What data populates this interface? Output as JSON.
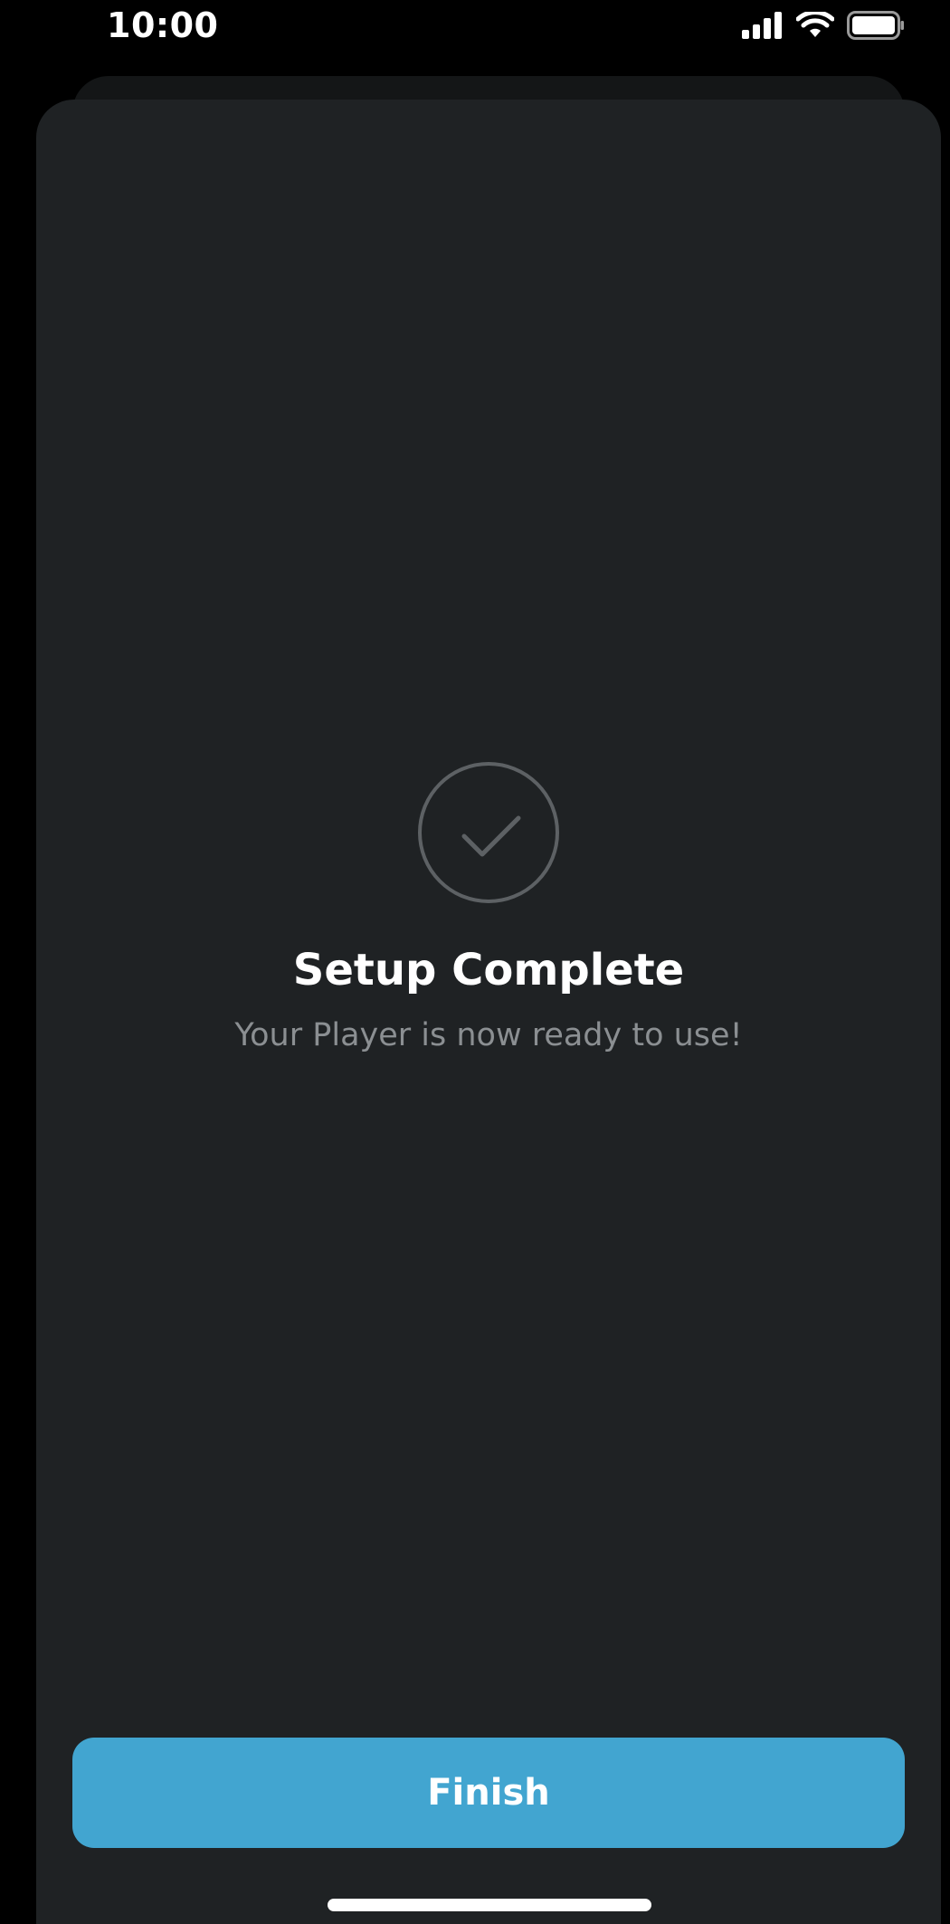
{
  "status_bar": {
    "time": "10:00",
    "icons": [
      "cellular-signal-icon",
      "wifi-icon",
      "battery-icon"
    ]
  },
  "main": {
    "icon": "checkmark-circle-icon",
    "title": "Setup Complete",
    "subtitle": "Your Player is now ready to use!"
  },
  "footer": {
    "finish_label": "Finish"
  },
  "colors": {
    "background": "#000000",
    "sheet": "#1f2224",
    "accent": "#42a5d0",
    "subtitle": "#8b8f92",
    "icon_stroke": "#5d6164"
  }
}
